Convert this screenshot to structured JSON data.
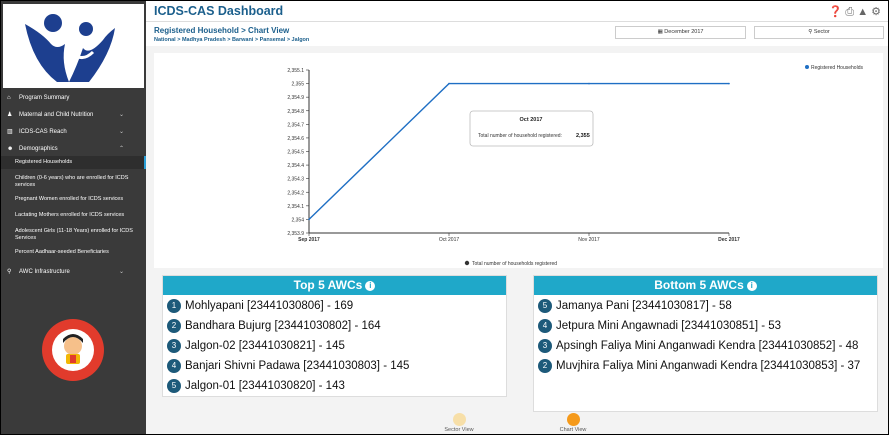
{
  "app": {
    "title": "ICDS-CAS Dashboard"
  },
  "top_icons": [
    "help-icon",
    "print-icon",
    "alert-icon",
    "gear-icon"
  ],
  "sidebar": {
    "items": [
      {
        "label": "Program Summary",
        "icon": "home-icon",
        "chevron": false
      },
      {
        "label": "Maternal and Child Nutrition",
        "icon": "child-icon",
        "chevron": true
      },
      {
        "label": "ICDS-CAS Reach",
        "icon": "chart-icon",
        "chevron": true
      },
      {
        "label": "Demographics",
        "icon": "users-icon",
        "chevron": true
      }
    ],
    "sub_items": [
      {
        "label": "Registered Households",
        "active": true
      },
      {
        "label": "Children (0-6 years) who are enrolled for ICDS services",
        "active": false
      },
      {
        "label": "Pregnant Women enrolled for ICDS services",
        "active": false
      },
      {
        "label": "Lactating Mothers enrolled for ICDS services",
        "active": false
      },
      {
        "label": "Adolescent Girls (11-18 Years) enrolled for ICDS Services",
        "active": false
      },
      {
        "label": "Percent Aadhaar-seeded Beneficiaries",
        "active": false
      }
    ],
    "last_item": {
      "label": "AWC Infrastructure",
      "icon": "building-icon",
      "chevron": true
    }
  },
  "header": {
    "title": "Registered Household",
    "view_label": "Chart View",
    "breadcrumb": "National > Madhya Pradesh > Barwani > Pansemal > Jalgon",
    "date_filter": "December 2017",
    "location_filter": "Sector"
  },
  "chart_data": {
    "type": "line",
    "x": [
      "Sep 2017",
      "Oct 2017",
      "Nov 2017",
      "Dec 2017"
    ],
    "series": [
      {
        "name": "Registered Households",
        "values": [
          2354,
          2355,
          2355,
          2355
        ]
      }
    ],
    "yticks": [
      "2,355.1",
      "2,355",
      "2,354.9",
      "2,354.8",
      "2,354.7",
      "2,354.6",
      "2,354.5",
      "2,354.4",
      "2,354.3",
      "2,354.2",
      "2,354.1",
      "2,354",
      "2,353.9"
    ],
    "ylim": [
      2353.9,
      2355.1
    ],
    "tooltip": {
      "title": "Oct 2017",
      "label": "Total number of household registered:",
      "value": "2,355"
    },
    "footnote": "Total number of households registered",
    "color": "#1f6fc4",
    "legend_position": "top-right"
  },
  "top5": {
    "title": "Top 5 AWCs",
    "rows": [
      {
        "rank": "1",
        "text": "Mohlyapani [23441030806] - 169"
      },
      {
        "rank": "2",
        "text": "Bandhara Bujurg [23441030802] - 164"
      },
      {
        "rank": "3",
        "text": "Jalgon-02 [23441030821] - 145"
      },
      {
        "rank": "4",
        "text": "Banjari Shivni Padawa [23441030803] - 145"
      },
      {
        "rank": "5",
        "text": "Jalgon-01 [23441030820] - 143"
      }
    ]
  },
  "bottom5": {
    "title": "Bottom 5 AWCs",
    "rows": [
      {
        "rank": "5",
        "text": "Jamanya Pani [23441030817] - 58"
      },
      {
        "rank": "4",
        "text": "Jetpura Mini Angawnadi [23441030851] - 53"
      },
      {
        "rank": "3",
        "text": "Apsingh Faliya Mini Anganwadi Kendra [23441030852] - 48"
      },
      {
        "rank": "2",
        "text": "Muvjhira Faliya Mini Anganwadi Kendra [23441030853] - 37"
      }
    ]
  },
  "view_toggle": {
    "sector": {
      "label": "Sector View",
      "color": "#f7dfa8"
    },
    "chart": {
      "label": "Chart View",
      "color": "#f59a1b"
    }
  }
}
